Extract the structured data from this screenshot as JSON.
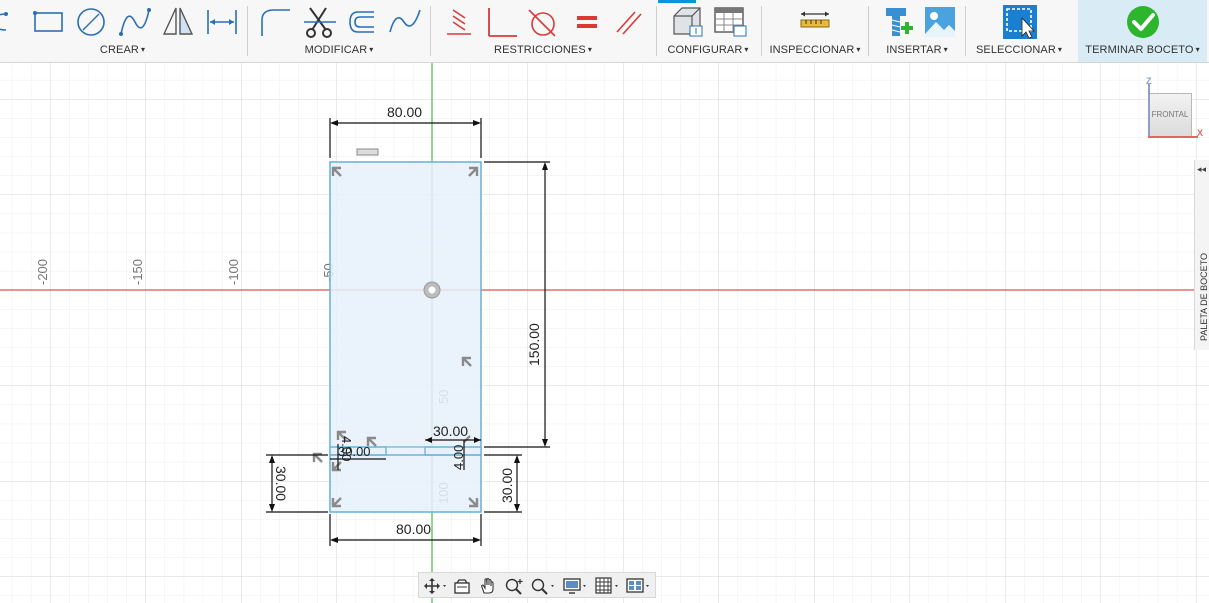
{
  "toolbar": {
    "groups": [
      {
        "label": "CREAR"
      },
      {
        "label": "MODIFICAR"
      },
      {
        "label": "RESTRICCIONES"
      },
      {
        "label": "CONFIGURAR"
      },
      {
        "label": "INSPECCIONAR"
      },
      {
        "label": "INSERTAR"
      },
      {
        "label": "SELECCIONAR"
      },
      {
        "label": "TERMINAR BOCETO"
      }
    ],
    "caret": "▾",
    "accent": "#0696d7",
    "finish_check_color": "#2db52d"
  },
  "viewcube": {
    "face": "FRONTAL",
    "axis_z": "Z",
    "axis_x": "X"
  },
  "palette": {
    "title": "PALETA DE BOCETO",
    "arrow": "◂◂"
  },
  "axis_labels": {
    "m200": "-200",
    "m150": "-150",
    "m100": "-100",
    "m50": "-50",
    "p50": "50",
    "p100": "100"
  },
  "dimensions": {
    "top_width": "80.00",
    "bottom_width": "80.00",
    "height": "150.00",
    "left_slot": "30.00",
    "right_slot": "30.00",
    "slot_width_right": "30.00",
    "slot_width_left": "30.00",
    "slot_thickness_left": "4.00",
    "slot_thickness_right": "4.00"
  },
  "colors": {
    "x_axis": "#e05050",
    "y_axis": "#4cbb4c",
    "profile_fill": "#e6f1fa",
    "profile_stroke": "#6eb4dc"
  }
}
